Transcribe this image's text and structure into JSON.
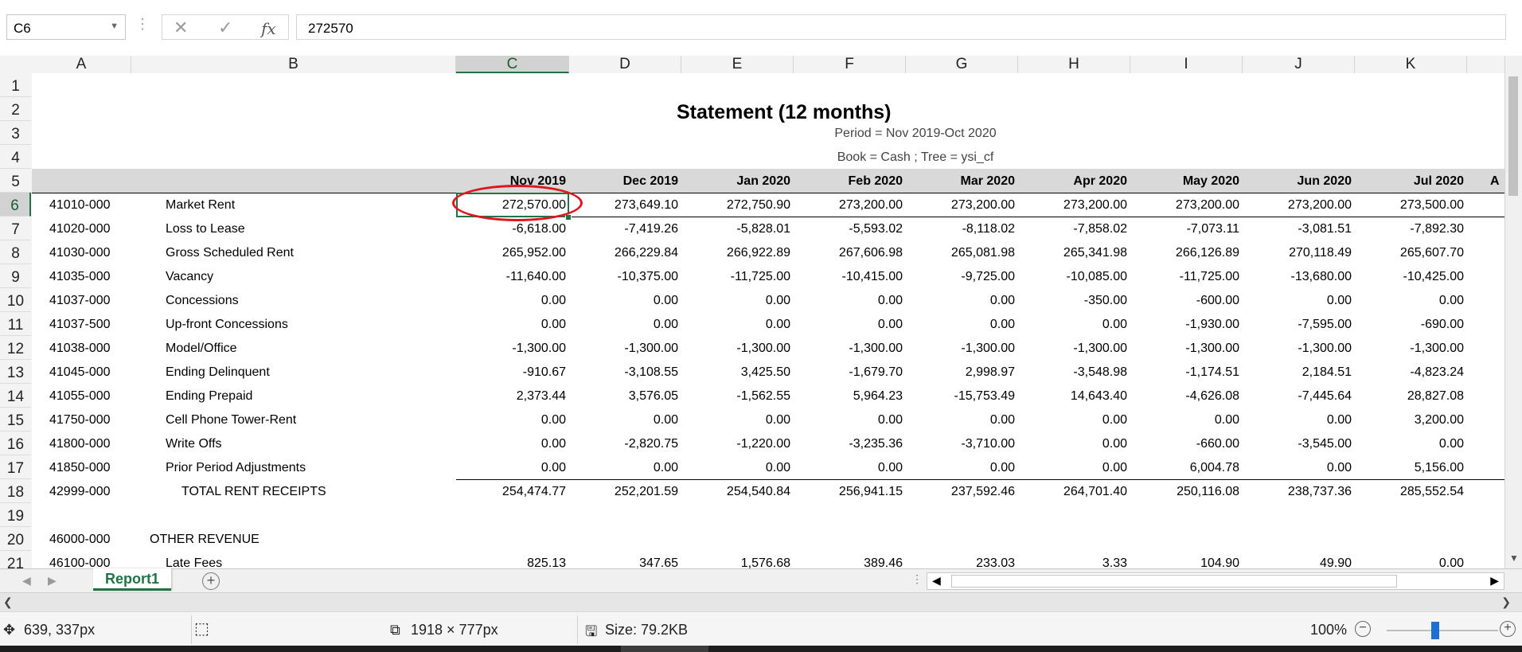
{
  "formula_bar": {
    "name_box": "C6",
    "cancel_icon": "✕",
    "enter_icon": "✓",
    "fx_label": "fx",
    "formula_value": "272570"
  },
  "columns": [
    "A",
    "B",
    "C",
    "D",
    "E",
    "F",
    "G",
    "H",
    "I",
    "J",
    "K"
  ],
  "rows": [
    "1",
    "2",
    "3",
    "4",
    "5",
    "6",
    "7",
    "8",
    "9",
    "10",
    "11",
    "12",
    "13",
    "14",
    "15",
    "16",
    "17",
    "18",
    "19",
    "20",
    "21"
  ],
  "report": {
    "title": "Statement (12 months)",
    "period": "Period = Nov 2019-Oct 2020",
    "book": "Book = Cash ; Tree = ysi_cf",
    "month_headers": [
      "Nov 2019",
      "Dec 2019",
      "Jan 2020",
      "Feb 2020",
      "Mar 2020",
      "Apr 2020",
      "May 2020",
      "Jun 2020",
      "Jul 2020"
    ],
    "clipped_header": "A",
    "lines": [
      {
        "code": "41010-000",
        "label": "Market Rent",
        "values": [
          "272,570.00",
          "273,649.10",
          "272,750.90",
          "273,200.00",
          "273,200.00",
          "273,200.00",
          "273,200.00",
          "273,200.00",
          "273,500.00"
        ]
      },
      {
        "code": "41020-000",
        "label": "Loss to Lease",
        "values": [
          "-6,618.00",
          "-7,419.26",
          "-5,828.01",
          "-5,593.02",
          "-8,118.02",
          "-7,858.02",
          "-7,073.11",
          "-3,081.51",
          "-7,892.30"
        ]
      },
      {
        "code": "41030-000",
        "label": "Gross Scheduled Rent",
        "values": [
          "265,952.00",
          "266,229.84",
          "266,922.89",
          "267,606.98",
          "265,081.98",
          "265,341.98",
          "266,126.89",
          "270,118.49",
          "265,607.70"
        ]
      },
      {
        "code": "41035-000",
        "label": "Vacancy",
        "values": [
          "-11,640.00",
          "-10,375.00",
          "-11,725.00",
          "-10,415.00",
          "-9,725.00",
          "-10,085.00",
          "-11,725.00",
          "-13,680.00",
          "-10,425.00"
        ]
      },
      {
        "code": "41037-000",
        "label": "Concessions",
        "values": [
          "0.00",
          "0.00",
          "0.00",
          "0.00",
          "0.00",
          "-350.00",
          "-600.00",
          "0.00",
          "0.00"
        ]
      },
      {
        "code": "41037-500",
        "label": "Up-front Concessions",
        "values": [
          "0.00",
          "0.00",
          "0.00",
          "0.00",
          "0.00",
          "0.00",
          "-1,930.00",
          "-7,595.00",
          "-690.00"
        ]
      },
      {
        "code": "41038-000",
        "label": "Model/Office",
        "values": [
          "-1,300.00",
          "-1,300.00",
          "-1,300.00",
          "-1,300.00",
          "-1,300.00",
          "-1,300.00",
          "-1,300.00",
          "-1,300.00",
          "-1,300.00"
        ]
      },
      {
        "code": "41045-000",
        "label": "Ending Delinquent",
        "values": [
          "-910.67",
          "-3,108.55",
          "3,425.50",
          "-1,679.70",
          "2,998.97",
          "-3,548.98",
          "-1,174.51",
          "2,184.51",
          "-4,823.24"
        ]
      },
      {
        "code": "41055-000",
        "label": "Ending Prepaid",
        "values": [
          "2,373.44",
          "3,576.05",
          "-1,562.55",
          "5,964.23",
          "-15,753.49",
          "14,643.40",
          "-4,626.08",
          "-7,445.64",
          "28,827.08"
        ]
      },
      {
        "code": "41750-000",
        "label": "Cell Phone Tower-Rent",
        "values": [
          "0.00",
          "0.00",
          "0.00",
          "0.00",
          "0.00",
          "0.00",
          "0.00",
          "0.00",
          "3,200.00"
        ]
      },
      {
        "code": "41800-000",
        "label": "Write Offs",
        "values": [
          "0.00",
          "-2,820.75",
          "-1,220.00",
          "-3,235.36",
          "-3,710.00",
          "0.00",
          "-660.00",
          "-3,545.00",
          "0.00"
        ]
      },
      {
        "code": "41850-000",
        "label": "Prior Period Adjustments",
        "values": [
          "0.00",
          "0.00",
          "0.00",
          "0.00",
          "0.00",
          "0.00",
          "6,004.78",
          "0.00",
          "5,156.00"
        ]
      },
      {
        "code": "42999-000",
        "label": "TOTAL RENT RECEIPTS",
        "values": [
          "254,474.77",
          "252,201.59",
          "254,540.84",
          "256,941.15",
          "237,592.46",
          "264,701.40",
          "250,116.08",
          "238,737.36",
          "285,552.54"
        ]
      }
    ],
    "other_revenue": {
      "code": "46000-000",
      "label": "OTHER REVENUE"
    },
    "late_fees": {
      "code": "46100-000",
      "label": "Late Fees",
      "values": [
        "825.13",
        "347.65",
        "1,576.68",
        "389.46",
        "233.03",
        "3.33",
        "104.90",
        "49.90",
        "0.00"
      ]
    }
  },
  "sheet_tabs": {
    "active": "Report1",
    "add_icon": "+"
  },
  "status_bar": {
    "cursor": "639, 337px",
    "dimensions": "1918 × 777px",
    "size": "Size: 79.2KB",
    "zoom": "100%",
    "zoom_out": "−",
    "zoom_in": "+"
  },
  "colors": {
    "accent_green": "#217346",
    "annotation_red": "#e0141c",
    "banner_gray": "#d9d9d9"
  }
}
